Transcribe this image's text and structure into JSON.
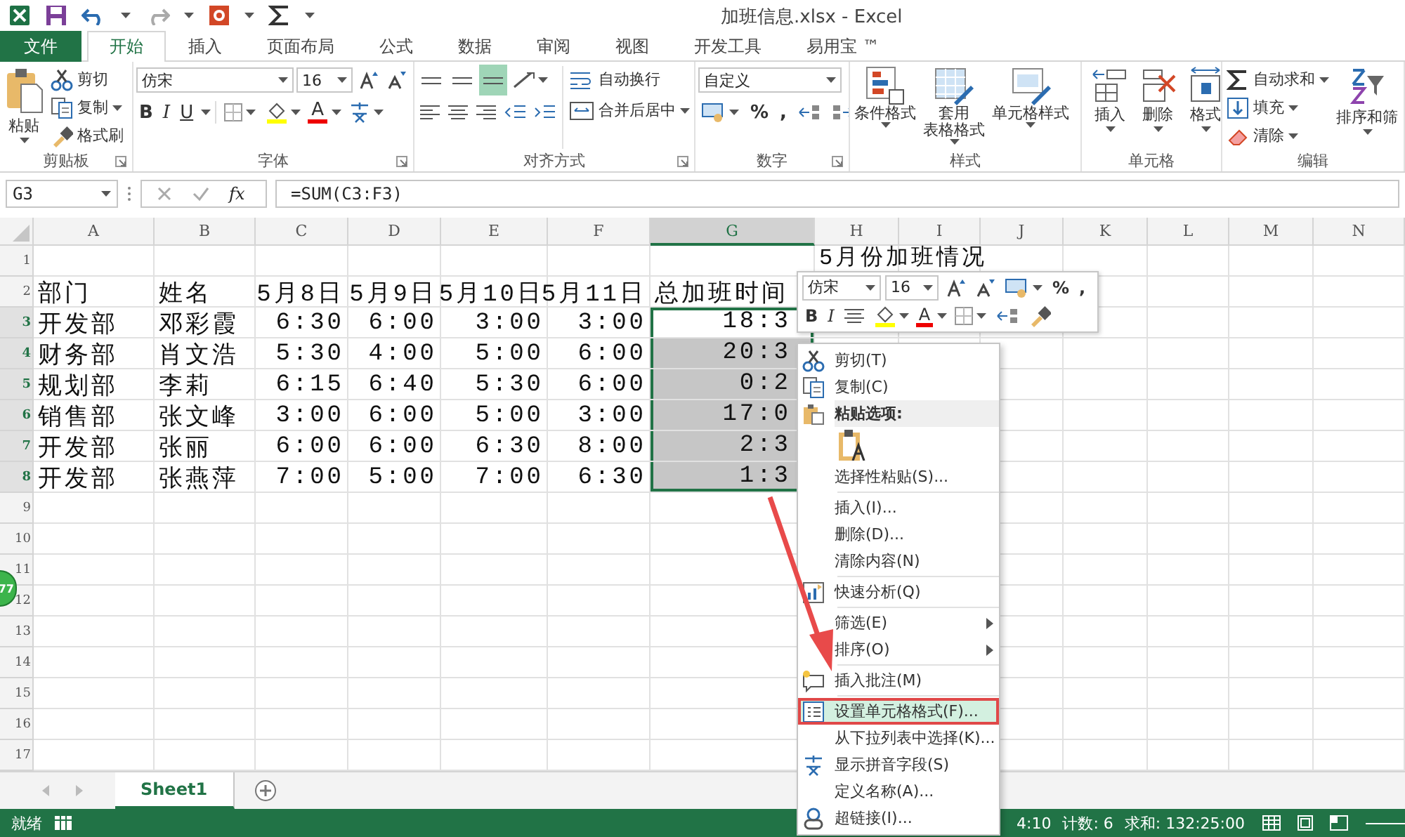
{
  "window": {
    "title": "加班信息.xlsx - Excel"
  },
  "ribbon_tabs": [
    {
      "label": "文件",
      "kind": "file",
      "selected": false
    },
    {
      "label": "开始",
      "kind": "tab",
      "selected": true
    },
    {
      "label": "插入",
      "kind": "tab",
      "selected": false
    },
    {
      "label": "页面布局",
      "kind": "tab",
      "selected": false
    },
    {
      "label": "公式",
      "kind": "tab",
      "selected": false
    },
    {
      "label": "数据",
      "kind": "tab",
      "selected": false
    },
    {
      "label": "审阅",
      "kind": "tab",
      "selected": false
    },
    {
      "label": "视图",
      "kind": "tab",
      "selected": false
    },
    {
      "label": "开发工具",
      "kind": "tab",
      "selected": false
    },
    {
      "label": "易用宝 ™",
      "kind": "tab",
      "selected": false
    }
  ],
  "ribbon_groups": [
    {
      "kind": "clipboard",
      "label": "剪贴板",
      "paste": "粘贴",
      "commands": [
        "剪切",
        "复制",
        "格式刷"
      ]
    },
    {
      "kind": "font",
      "label": "字体",
      "font": "仿宋",
      "size": "16",
      "styles": [
        "B",
        "I",
        "U"
      ],
      "font_color": "A"
    },
    {
      "kind": "alignment",
      "label": "对齐方式",
      "vertical_align": [
        {
          "selected": false
        },
        {
          "selected": false
        },
        {
          "selected": true
        }
      ],
      "commands": [
        "自动换行",
        "合并后居中"
      ]
    },
    {
      "kind": "number",
      "label": "数字",
      "format": "自定义",
      "symbols": [
        "%",
        ","
      ]
    },
    {
      "kind": "styles",
      "label": "样式",
      "commands": [
        {
          "lines": [
            "条件格式"
          ]
        },
        {
          "lines": [
            "套用",
            "表格格式"
          ]
        },
        {
          "lines": [
            "单元格样式"
          ]
        }
      ]
    },
    {
      "kind": "cells",
      "label": "单元格",
      "commands": [
        "插入",
        "删除",
        "格式"
      ]
    },
    {
      "kind": "editing",
      "label": "编辑",
      "commands": [
        "自动求和",
        "填充",
        "清除"
      ],
      "sort": "排序和筛"
    }
  ],
  "formula_bar": {
    "name_box": "G3",
    "fx": "fx",
    "formula": "=SUM(C3:F3)"
  },
  "columns": [
    {
      "label": "A",
      "selected": false
    },
    {
      "label": "B",
      "selected": false
    },
    {
      "label": "C",
      "selected": false
    },
    {
      "label": "D",
      "selected": false
    },
    {
      "label": "E",
      "selected": false
    },
    {
      "label": "F",
      "selected": false
    },
    {
      "label": "G",
      "selected": true
    },
    {
      "label": "H",
      "selected": false
    },
    {
      "label": "I",
      "selected": false
    },
    {
      "label": "J",
      "selected": false
    },
    {
      "label": "K",
      "selected": false
    },
    {
      "label": "L",
      "selected": false
    },
    {
      "label": "M",
      "selected": false
    },
    {
      "label": "N",
      "selected": false
    }
  ],
  "rows": [
    {
      "header": "1",
      "kind": "title",
      "selected": false,
      "title": "5月份加班情况"
    },
    {
      "header": "2",
      "kind": "header",
      "selected": false,
      "cells": [
        "部门",
        "姓名",
        "5月8日",
        "5月9日",
        "5月10日",
        "5月11日",
        "总加班时间"
      ]
    },
    {
      "header": "3",
      "kind": "data",
      "selected": true,
      "active": true,
      "cells": [
        "开发部",
        "邓彩霞",
        "6:30",
        "6:00",
        "3:00",
        "3:00",
        "18:3"
      ]
    },
    {
      "header": "4",
      "kind": "data",
      "selected": true,
      "active": false,
      "cells": [
        "财务部",
        "肖文浩",
        "5:30",
        "4:00",
        "5:00",
        "6:00",
        "20:3"
      ]
    },
    {
      "header": "5",
      "kind": "data",
      "selected": true,
      "active": false,
      "cells": [
        "规划部",
        "李莉",
        "6:15",
        "6:40",
        "5:30",
        "6:00",
        "0:2"
      ]
    },
    {
      "header": "6",
      "kind": "data",
      "selected": true,
      "active": false,
      "cells": [
        "销售部",
        "张文峰",
        "3:00",
        "6:00",
        "5:00",
        "3:00",
        "17:0"
      ]
    },
    {
      "header": "7",
      "kind": "data",
      "selected": true,
      "active": false,
      "cells": [
        "开发部",
        "张丽",
        "6:00",
        "6:00",
        "6:30",
        "8:00",
        "2:3"
      ]
    },
    {
      "header": "8",
      "kind": "data",
      "selected": true,
      "active": false,
      "cells": [
        "开发部",
        "张燕萍",
        "7:00",
        "5:00",
        "7:00",
        "6:30",
        "1:3"
      ]
    },
    {
      "header": "9",
      "kind": "empty",
      "selected": false
    },
    {
      "header": "10",
      "kind": "empty",
      "selected": false
    },
    {
      "header": "11",
      "kind": "empty",
      "selected": false
    },
    {
      "header": "12",
      "kind": "empty",
      "selected": false
    },
    {
      "header": "13",
      "kind": "empty",
      "selected": false
    },
    {
      "header": "14",
      "kind": "empty",
      "selected": false
    },
    {
      "header": "15",
      "kind": "empty",
      "selected": false
    },
    {
      "header": "16",
      "kind": "empty",
      "selected": false
    },
    {
      "header": "17",
      "kind": "empty",
      "selected": false
    }
  ],
  "mini_toolbar": {
    "font": "仿宋",
    "size": "16",
    "symbols": [
      "%",
      ","
    ],
    "styles": [
      "B",
      "I"
    ],
    "font_color": "A"
  },
  "context_menu": {
    "items": [
      {
        "kind": "command",
        "label": "剪切(T)",
        "selected": false,
        "outlined": false
      },
      {
        "kind": "command",
        "label": "复制(C)",
        "selected": false,
        "outlined": false
      },
      {
        "kind": "header",
        "label": "粘贴选项:"
      },
      {
        "kind": "paste-option",
        "selected": false,
        "outlined": false
      },
      {
        "kind": "command",
        "label": "选择性粘贴(S)...",
        "selected": false,
        "outlined": false
      },
      {
        "kind": "separator"
      },
      {
        "kind": "command",
        "label": "插入(I)...",
        "selected": false,
        "outlined": false
      },
      {
        "kind": "command",
        "label": "删除(D)...",
        "selected": false,
        "outlined": false
      },
      {
        "kind": "command",
        "label": "清除内容(N)",
        "selected": false,
        "outlined": false
      },
      {
        "kind": "separator"
      },
      {
        "kind": "command",
        "label": "快速分析(Q)",
        "selected": false,
        "outlined": false
      },
      {
        "kind": "separator"
      },
      {
        "kind": "submenu",
        "label": "筛选(E)",
        "selected": false,
        "outlined": false
      },
      {
        "kind": "submenu",
        "label": "排序(O)",
        "selected": false,
        "outlined": false
      },
      {
        "kind": "separator"
      },
      {
        "kind": "command",
        "label": "插入批注(M)",
        "selected": false,
        "outlined": false
      },
      {
        "kind": "separator"
      },
      {
        "kind": "command",
        "label": "设置单元格格式(F)...",
        "selected": true,
        "outlined": true
      },
      {
        "kind": "command",
        "label": "从下拉列表中选择(K)...",
        "selected": false,
        "outlined": false
      },
      {
        "kind": "command",
        "label": "显示拼音字段(S)",
        "selected": false,
        "outlined": false
      },
      {
        "kind": "command",
        "label": "定义名称(A)...",
        "selected": false,
        "outlined": false
      },
      {
        "kind": "command",
        "label": "超链接(I)...",
        "selected": false,
        "outlined": false
      }
    ]
  },
  "annotation": {
    "kind": "arrow"
  },
  "floating_badge": {
    "text": "77"
  },
  "sheet_tabs": [
    {
      "label": "Sheet1",
      "selected": true
    }
  ],
  "status_bar": {
    "mode": "就绪",
    "average": "4:10",
    "count": "计数: 6",
    "sum": "求和: 132:25:00"
  }
}
